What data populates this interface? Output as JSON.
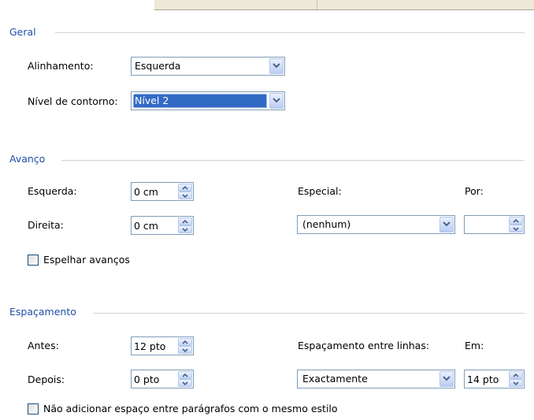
{
  "sections": {
    "geral": "Geral",
    "avanco": "Avanço",
    "espacamento": "Espaçamento"
  },
  "geral": {
    "alinhamento_label": "Alinhamento:",
    "alinhamento_value": "Esquerda",
    "nivel_label": "Nível de contorno:",
    "nivel_value": "Nível 2"
  },
  "avanco": {
    "esquerda_label": "Esquerda:",
    "esquerda_value": "0 cm",
    "direita_label": "Direita:",
    "direita_value": "0 cm",
    "especial_label": "Especial:",
    "especial_value": "(nenhum)",
    "por_label": "Por:",
    "por_value": "",
    "espelhar_label": "Espelhar avanços",
    "espelhar_checked": false
  },
  "espacamento": {
    "antes_label": "Antes:",
    "antes_value": "12 pto",
    "depois_label": "Depois:",
    "depois_value": "0 pto",
    "entre_linhas_label": "Espaçamento entre linhas:",
    "entre_linhas_value": "Exactamente",
    "em_label": "Em:",
    "em_value": "14 pto",
    "nao_adicionar_label": "Não adicionar espaço entre parágrafos com o mesmo estilo",
    "nao_adicionar_checked": false
  },
  "icons": {
    "dropdown": "chevron-down-icon",
    "spin_up": "arrow-up-icon",
    "spin_down": "arrow-down-icon"
  },
  "colors": {
    "section_title": "#1f4ea8",
    "selection": "#316ac5",
    "field_border": "#7f9db9"
  }
}
